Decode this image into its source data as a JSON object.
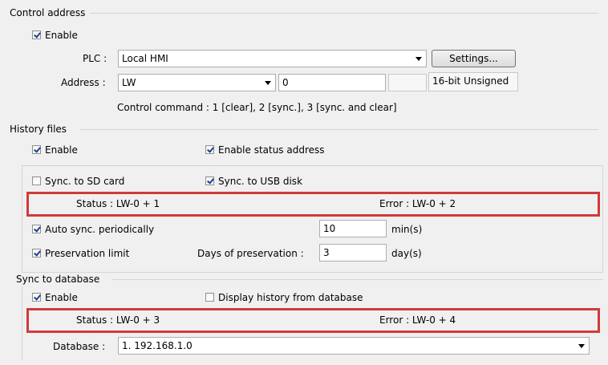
{
  "control_address": {
    "title": "Control address",
    "enable_label": "Enable",
    "enable_checked": true,
    "plc_label": "PLC :",
    "plc_value": "Local HMI",
    "settings_label": "Settings...",
    "address_label": "Address :",
    "address_device": "LW",
    "address_value": "0",
    "data_type": "16-bit Unsigned",
    "command_text": "Control command : 1 [clear], 2 [sync.], 3 [sync. and clear]"
  },
  "history_files": {
    "title": "History files",
    "enable_label": "Enable",
    "enable_checked": true,
    "enable_status_label": "Enable status address",
    "enable_status_checked": true,
    "sync_sd_label": "Sync. to SD card",
    "sync_sd_checked": false,
    "sync_usb_label": "Sync. to USB disk",
    "sync_usb_checked": true,
    "status_text": "Status : LW-0 + 1",
    "error_text": "Error : LW-0 + 2",
    "auto_sync_label": "Auto sync. periodically",
    "auto_sync_checked": true,
    "auto_sync_value": "10",
    "auto_sync_unit": "min(s)",
    "preservation_label": "Preservation limit",
    "preservation_checked": true,
    "days_label": "Days of preservation :",
    "days_value": "3",
    "days_unit": "day(s)"
  },
  "sync_database": {
    "title": "Sync to database",
    "enable_label": "Enable",
    "enable_checked": true,
    "display_history_label": "Display history from database",
    "display_history_checked": false,
    "status_text": "Status : LW-0 + 3",
    "error_text": "Error : LW-0 + 4",
    "database_label": "Database :",
    "database_value": "1. 192.168.1.0"
  },
  "colors": {
    "highlight_border": "#d23a3a",
    "check_mark": "#1b3f91",
    "background": "#f0f0f0"
  }
}
